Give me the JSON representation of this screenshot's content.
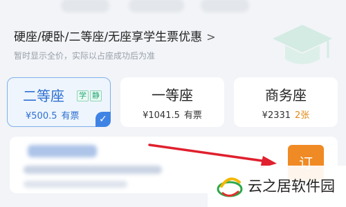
{
  "promo": {
    "title": "硬座/硬卧/二等座/无座享学生票优惠",
    "chevron": ">",
    "subtitle": "暂时显示全价，实际以占座成功后为准"
  },
  "seats": [
    {
      "name": "二等座",
      "tags": [
        "学",
        "静"
      ],
      "price": "¥500.5",
      "availability": "有票",
      "selected": true
    },
    {
      "name": "一等座",
      "tags": [],
      "price": "¥1041.5",
      "availability": "有票",
      "selected": false
    },
    {
      "name": "商务座",
      "tags": [],
      "price": "¥2331",
      "availability": "2张",
      "selected": false
    }
  ],
  "book_button": {
    "label": "订"
  },
  "watermark": {
    "text": "云之居软件园"
  },
  "colors": {
    "accent": "#3f84e5",
    "book_button": "#f08a24",
    "warning": "#e08a17",
    "arrow": "#e0202e"
  },
  "icons": {
    "selected_check": "checkmark-icon",
    "graduation": "graduation-cap-icon",
    "watermark_logo": "swirl-logo-icon"
  }
}
